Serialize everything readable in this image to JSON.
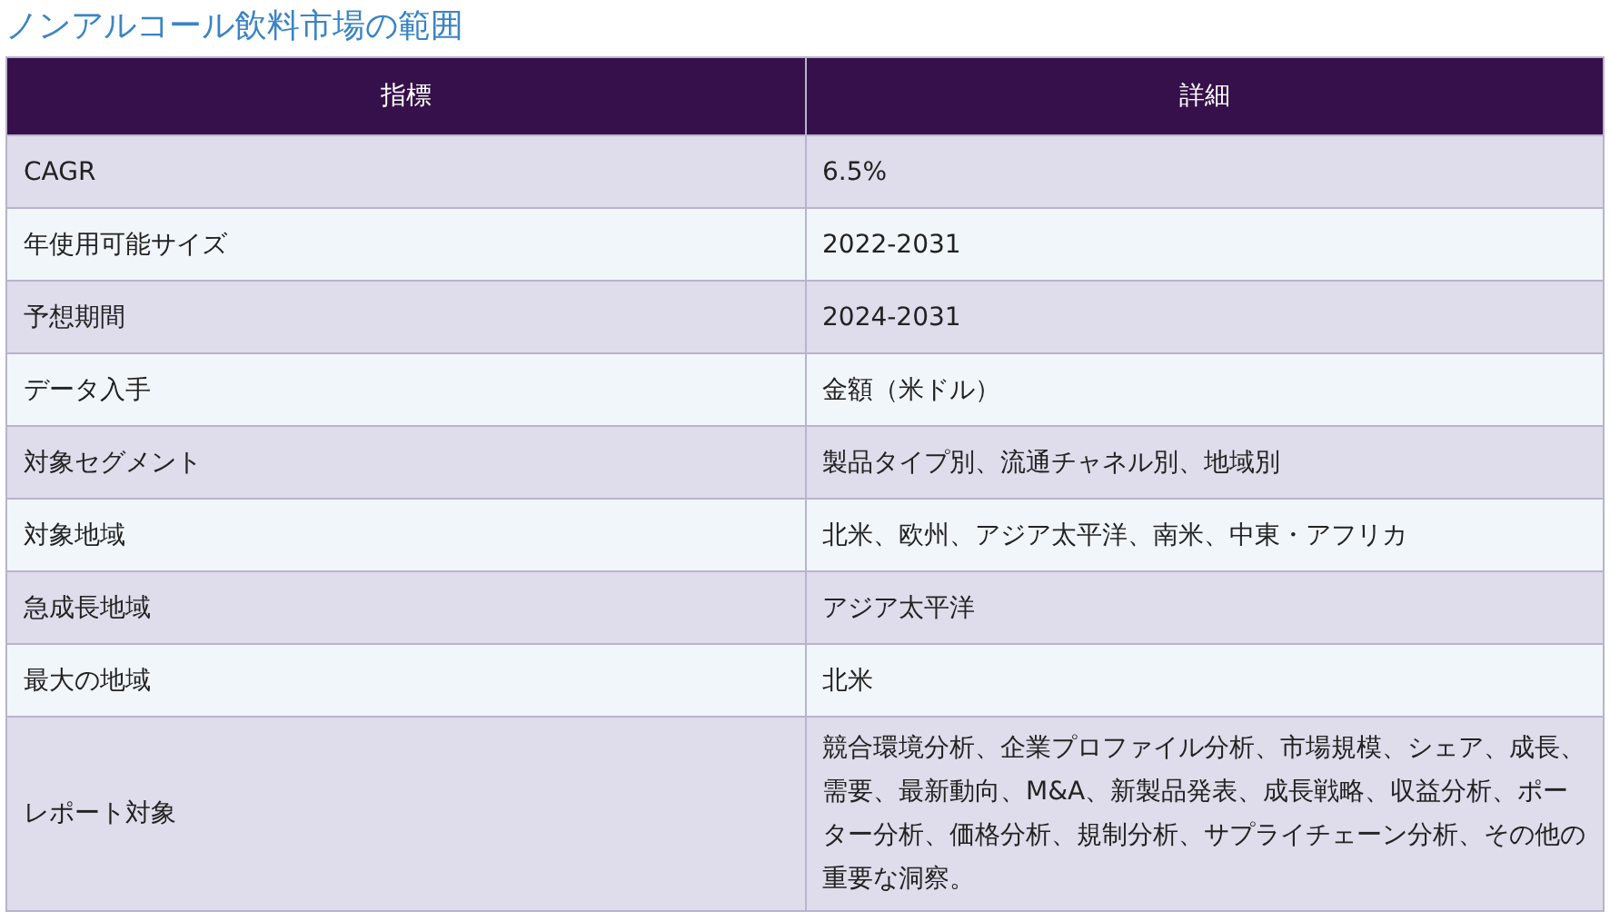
{
  "title": "ノンアルコール飲料市場の範囲",
  "table": {
    "columns": [
      "指標",
      "詳細"
    ],
    "rows": [
      [
        "CAGR",
        "6.5%"
      ],
      [
        "年使用可能サイズ",
        "2022-2031"
      ],
      [
        "予想期間",
        "2024-2031"
      ],
      [
        "データ入手",
        "金額（米ドル）"
      ],
      [
        "対象セグメント",
        "製品タイプ別、流通チャネル別、地域別"
      ],
      [
        "対象地域",
        "北米、欧州、アジア太平洋、南米、中東・アフリカ"
      ],
      [
        "急成長地域",
        "アジア太平洋"
      ],
      [
        "最大の地域",
        "北米"
      ],
      [
        "レポート対象",
        "競合環境分析、企業プロファイル分析、市場規模、シェア、成長、需要、最新動向、M&A、新製品発表、成長戦略、収益分析、ポーター分析、価格分析、規制分析、サプライチェーン分析、その他の重要な洞察。"
      ]
    ]
  }
}
